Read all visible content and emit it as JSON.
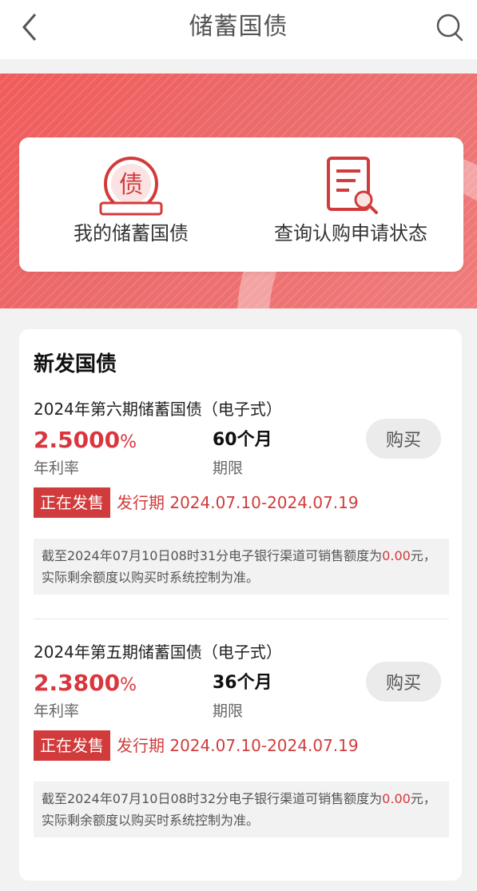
{
  "nav": {
    "title": "储蓄国债",
    "back_icon": "chevron-left-icon",
    "search_icon": "search-icon"
  },
  "quick": {
    "my_bonds": {
      "label": "我的储蓄国债",
      "icon_text": "债",
      "icon": "bond-badge-icon"
    },
    "query_status": {
      "label": "查询认购申请状态",
      "icon": "document-search-icon"
    }
  },
  "section": {
    "title": "新发国债"
  },
  "colors": {
    "accent": "#d23b3b",
    "banner": "#f15b5b"
  },
  "bonds": [
    {
      "name": "2024年第六期储蓄国债（电子式）",
      "rate": "2.5000",
      "rate_unit": "%",
      "rate_label": "年利率",
      "term": "60个月",
      "term_label": "期限",
      "buy_label": "购买",
      "status": "正在发售",
      "period": "发行期 2024.07.10-2024.07.19",
      "notice_prefix": "截至2024年07月10日08时31分电子银行渠道可销售额度为",
      "notice_amount": "0.00",
      "notice_suffix": "元，实际剩余额度以购买时系统控制为准。"
    },
    {
      "name": "2024年第五期储蓄国债（电子式）",
      "rate": "2.3800",
      "rate_unit": "%",
      "rate_label": "年利率",
      "term": "36个月",
      "term_label": "期限",
      "buy_label": "购买",
      "status": "正在发售",
      "period": "发行期 2024.07.10-2024.07.19",
      "notice_prefix": "截至2024年07月10日08时32分电子银行渠道可销售额度为",
      "notice_amount": "0.00",
      "notice_suffix": "元，实际剩余额度以购买时系统控制为准。"
    }
  ]
}
